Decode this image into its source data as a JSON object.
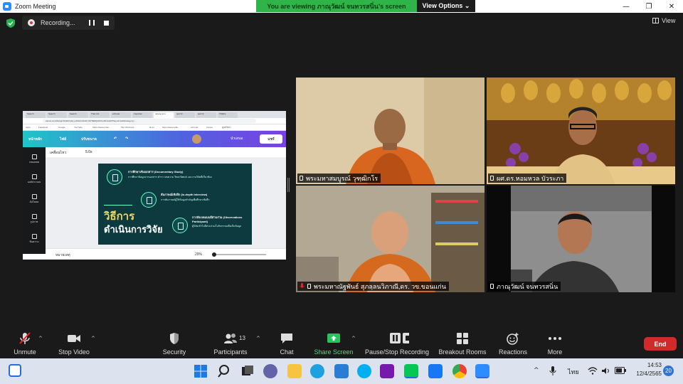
{
  "window": {
    "title": "Zoom Meeting",
    "controls": [
      "—",
      "❐",
      "✕"
    ]
  },
  "share_banner": {
    "viewing": "You are viewing ภาณุวัฒน์ จนทวรสนิ่น's screen",
    "view_options": "View Options ⌄"
  },
  "recording": {
    "status": "Recording..."
  },
  "view_button": {
    "label": "View"
  },
  "shared_screen": {
    "browser_tabs": [
      "Search",
      "Search",
      "Search",
      "That Chi",
      "ezCode",
      "Importan",
      "canva.com",
      "quiz.R",
      "quiz.R",
      "TOEFL"
    ],
    "url": "canva.com/design/DAE9rrp2y-pAl/H4n1Ks0-hH7Rk8QaOhUehKvbsM/?layout=edit&category=...",
    "bookmarks": [
      "Apps",
      "Facebook",
      "Google",
      "YouTube",
      "https://www.prote...",
      "http://dcresca...",
      "Docs",
      "https://www.refle...",
      "ezCode",
      "Canva",
      "ศูนย์วิทยา"
    ],
    "canva_menu": [
      "หน้าหลัก",
      "ไฟล์",
      "ปรับขนาด"
    ],
    "canva_present": "นำเสนอ",
    "canva_share": "แชร์",
    "tool_items": [
      "เคลื่อนไหว",
      "5.0s"
    ],
    "side_items": [
      "เทมเพลต",
      "องค์ประกอบ",
      "อัปโหลด",
      "รูปภาพ",
      "ข้อความ"
    ],
    "slide": {
      "items": [
        {
          "title": "การศึกษาเชิงเอกสาร (Documentary Study)",
          "text": "การศึกษาข้อมูลจากเอกสาร ตำรา บทความ วิทยานิพนธ์ และงานวิจัยที่เกี่ยวข้อง"
        },
        {
          "title": "สัมภาษณ์เชิงลึก (In-depth Interview)",
          "text": "การสัมภาษณ์ผู้ให้ข้อมูลสำคัญเพื่อศึกษาเชิงลึก"
        },
        {
          "title": "การสังเกตแบบมีส่วนร่วม (Observations Participant)",
          "text": "ผู้วิจัยเข้าไปมีส่วนร่วมในกิจกรรมเพื่อเก็บข้อมูล"
        }
      ],
      "title_line1": "วิธีการ",
      "title_line2": "ดำเนินการวิจัย"
    },
    "bottom": {
      "notes": "หมายเหตุ",
      "zoom": "29%"
    }
  },
  "participants": [
    {
      "name": "พระมหาสมบูรณ์ วุฑฺฒิกโร",
      "muted": false
    },
    {
      "name": "ผศ.ดร.หอมหวล บัวระภา",
      "muted": false
    },
    {
      "name": "พระมหาณัฐพันธ์ สุภลฺลนวิภาณี,ดร. วข.ขอนแก่น",
      "muted": true
    },
    {
      "name": "ภาณุวัฒน์ จนทวรสนิ่น",
      "muted": false
    }
  ],
  "toolbar": {
    "unmute": "Unmute",
    "stop_video": "Stop Video",
    "security": "Security",
    "participants": "Participants",
    "participants_count": "13",
    "chat": "Chat",
    "share_screen": "Share Screen",
    "pause_recording": "Pause/Stop Recording",
    "breakout": "Breakout Rooms",
    "reactions": "Reactions",
    "more": "More",
    "end": "End"
  },
  "taskbar": {
    "language": "ไทย",
    "time": "14:53",
    "date": "12/4/2565",
    "notifications": "20"
  },
  "colors": {
    "banner_green": "#2fb44a",
    "end_red": "#d02a2a",
    "share_green": "#22c55e",
    "slide_bg": "#0d3a3f",
    "slide_accent": "#f2d65a"
  }
}
